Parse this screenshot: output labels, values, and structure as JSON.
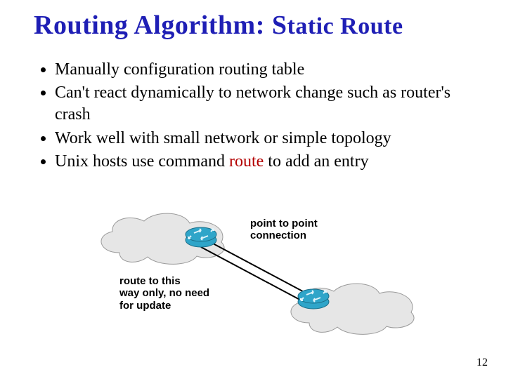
{
  "title": {
    "main": "Routing Algorithm: ",
    "s": "S",
    "rest": "tatic Route"
  },
  "bullets": [
    "Manually configuration routing table",
    "Can't react dynamically to network change such as router's crash",
    "Work well with small network or simple topology"
  ],
  "bullet4": {
    "pre": "Unix hosts use command ",
    "cmd": "route",
    "post": " to add an entry"
  },
  "labels": {
    "ptp1": "point to point",
    "ptp2": "connection",
    "route1": "route to this",
    "route2": "way only, no need",
    "route3": "for update"
  },
  "page_number": "12"
}
